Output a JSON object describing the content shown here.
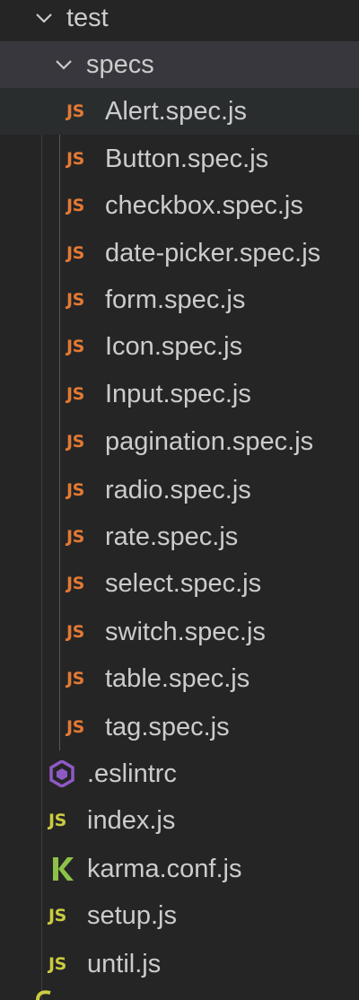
{
  "tree": {
    "root_folder": "test",
    "sub_folder": "specs",
    "spec_files": [
      "Alert.spec.js",
      "Button.spec.js",
      "checkbox.spec.js",
      "date-picker.spec.js",
      "form.spec.js",
      "Icon.spec.js",
      "Input.spec.js",
      "pagination.spec.js",
      "radio.spec.js",
      "rate.spec.js",
      "select.spec.js",
      "switch.spec.js",
      "table.spec.js",
      "tag.spec.js"
    ],
    "test_files": [
      {
        "name": ".eslintrc",
        "icon": "eslint-icon"
      },
      {
        "name": "index.js",
        "icon": "js-icon"
      },
      {
        "name": "karma.conf.js",
        "icon": "karma-icon"
      },
      {
        "name": "setup.js",
        "icon": "js-icon"
      },
      {
        "name": "until.js",
        "icon": "js-icon"
      }
    ],
    "js_badge": "JS",
    "colors": {
      "background": "#252526",
      "selected_row": "#37373d",
      "text": "#cccccc",
      "js_orange": "#e37933",
      "js_yellow": "#cbcb41",
      "eslint_purple": "#8f59c4",
      "karma_green": "#8dc149"
    }
  }
}
